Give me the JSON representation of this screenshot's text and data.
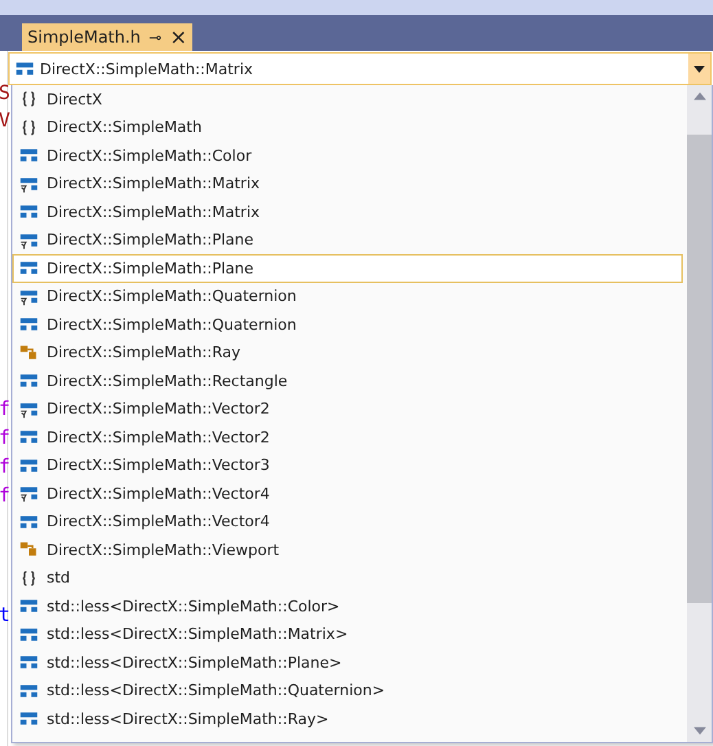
{
  "tab": {
    "title": "SimpleMath.h",
    "pin": "⊸",
    "close": "×"
  },
  "combo": {
    "kind": "class",
    "value": "DirectX::SimpleMath::Matrix"
  },
  "editor_fragments": [
    {
      "text": "S",
      "color": "#a31515"
    },
    {
      "text": "V",
      "color": "#a31515"
    },
    {
      "text": "f",
      "color": "#af00db"
    },
    {
      "text": "f",
      "color": "#af00db"
    },
    {
      "text": "f",
      "color": "#af00db"
    },
    {
      "text": "f",
      "color": "#af00db"
    },
    {
      "text": "t",
      "color": "#0000ff"
    }
  ],
  "items": [
    {
      "kind": "namespace",
      "label": "DirectX",
      "selected": false
    },
    {
      "kind": "namespace",
      "label": "DirectX::SimpleMath",
      "selected": false
    },
    {
      "kind": "class",
      "label": "DirectX::SimpleMath::Color",
      "selected": false
    },
    {
      "kind": "typedef",
      "label": "DirectX::SimpleMath::Matrix",
      "selected": false
    },
    {
      "kind": "class",
      "label": "DirectX::SimpleMath::Matrix",
      "selected": false
    },
    {
      "kind": "typedef",
      "label": "DirectX::SimpleMath::Plane",
      "selected": false
    },
    {
      "kind": "class",
      "label": "DirectX::SimpleMath::Plane",
      "selected": true
    },
    {
      "kind": "typedef",
      "label": "DirectX::SimpleMath::Quaternion",
      "selected": false
    },
    {
      "kind": "class",
      "label": "DirectX::SimpleMath::Quaternion",
      "selected": false
    },
    {
      "kind": "struct",
      "label": "DirectX::SimpleMath::Ray",
      "selected": false
    },
    {
      "kind": "class",
      "label": "DirectX::SimpleMath::Rectangle",
      "selected": false
    },
    {
      "kind": "typedef",
      "label": "DirectX::SimpleMath::Vector2",
      "selected": false
    },
    {
      "kind": "class",
      "label": "DirectX::SimpleMath::Vector2",
      "selected": false
    },
    {
      "kind": "class",
      "label": "DirectX::SimpleMath::Vector3",
      "selected": false
    },
    {
      "kind": "typedef",
      "label": "DirectX::SimpleMath::Vector4",
      "selected": false
    },
    {
      "kind": "class",
      "label": "DirectX::SimpleMath::Vector4",
      "selected": false
    },
    {
      "kind": "struct",
      "label": "DirectX::SimpleMath::Viewport",
      "selected": false
    },
    {
      "kind": "namespace",
      "label": "std",
      "selected": false
    },
    {
      "kind": "class",
      "label": "std::less<DirectX::SimpleMath::Color>",
      "selected": false
    },
    {
      "kind": "class",
      "label": "std::less<DirectX::SimpleMath::Matrix>",
      "selected": false
    },
    {
      "kind": "class",
      "label": "std::less<DirectX::SimpleMath::Plane>",
      "selected": false
    },
    {
      "kind": "class",
      "label": "std::less<DirectX::SimpleMath::Quaternion>",
      "selected": false
    },
    {
      "kind": "class",
      "label": "std::less<DirectX::SimpleMath::Ray>",
      "selected": false
    }
  ]
}
